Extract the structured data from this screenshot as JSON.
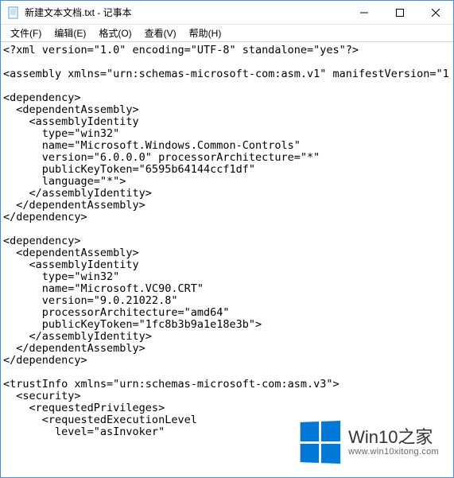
{
  "window": {
    "title": "新建文本文档.txt - 记事本"
  },
  "menu": {
    "file": "文件(F)",
    "edit": "编辑(E)",
    "format": "格式(O)",
    "view": "查看(V)",
    "help": "帮助(H)"
  },
  "editor": {
    "content": "<?xml version=\"1.0\" encoding=\"UTF-8\" standalone=\"yes\"?>\n\n<assembly xmlns=\"urn:schemas-microsoft-com:asm.v1\" manifestVersion=\"1\n\n<dependency>\n  <dependentAssembly>\n    <assemblyIdentity\n      type=\"win32\"\n      name=\"Microsoft.Windows.Common-Controls\"\n      version=\"6.0.0.0\" processorArchitecture=\"*\"\n      publicKeyToken=\"6595b64144ccf1df\"\n      language=\"*\">\n    </assemblyIdentity>\n  </dependentAssembly>\n</dependency>\n\n<dependency>\n  <dependentAssembly>\n    <assemblyIdentity\n      type=\"win32\"\n      name=\"Microsoft.VC90.CRT\"\n      version=\"9.0.21022.8\"\n      processorArchitecture=\"amd64\"\n      publicKeyToken=\"1fc8b3b9a1e18e3b\">\n    </assemblyIdentity>\n  </dependentAssembly>\n</dependency>\n\n<trustInfo xmlns=\"urn:schemas-microsoft-com:asm.v3\">\n  <security>\n    <requestedPrivileges>\n      <requestedExecutionLevel\n        level=\"asInvoker\""
  },
  "watermark": {
    "main": "Win10之家",
    "sub": "www.win10xitong.com"
  }
}
